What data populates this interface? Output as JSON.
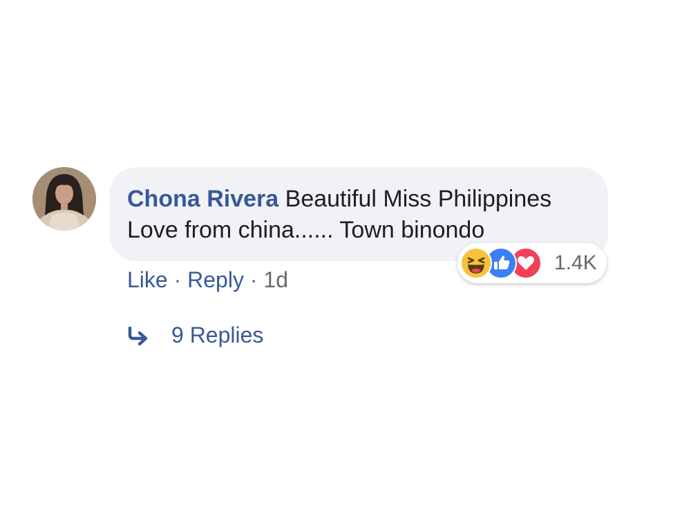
{
  "comment": {
    "author": "Chona Rivera",
    "text_line1": "Beautiful Miss Philippines",
    "text_line2": "Love from china...... Town binondo",
    "reactions": {
      "icons": [
        "haha-icon",
        "like-icon",
        "love-icon"
      ],
      "count": "1.4K"
    },
    "actions": {
      "like_label": "Like",
      "separator": "·",
      "reply_label": "Reply",
      "timestamp": "1d"
    },
    "replies": {
      "icon": "reply-arrow-icon",
      "label": "9 Replies"
    }
  },
  "colors": {
    "link": "#385898",
    "bubble": "#f0f2f5",
    "text": "#1c1e21",
    "muted": "#65676b",
    "haha": "#f7c23b",
    "like": "#3a80f5",
    "love": "#f0405a"
  }
}
